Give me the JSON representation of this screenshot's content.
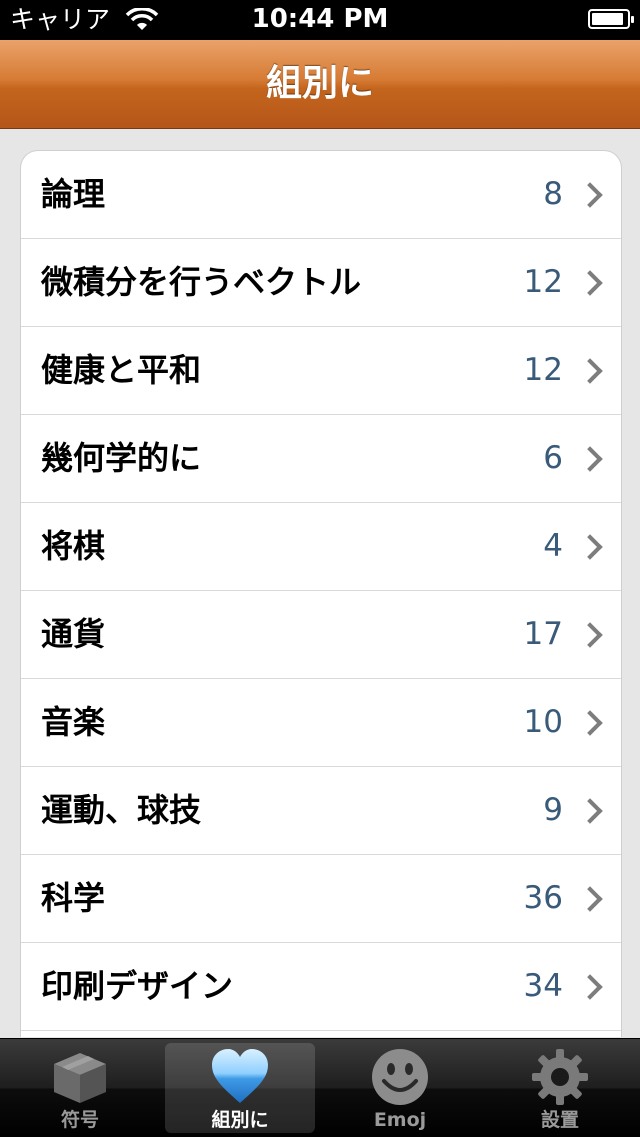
{
  "status_bar": {
    "carrier": "キャリア",
    "time": "10:44 PM",
    "battery_level": 0.9
  },
  "nav": {
    "title": "組別に"
  },
  "list": {
    "items": [
      {
        "label": "論理",
        "count": "8"
      },
      {
        "label": "微積分を行うベクトル",
        "count": "12"
      },
      {
        "label": "健康と平和",
        "count": "12"
      },
      {
        "label": "幾何学的に",
        "count": "6"
      },
      {
        "label": "将棋",
        "count": "4"
      },
      {
        "label": "通貨",
        "count": "17"
      },
      {
        "label": "音楽",
        "count": "10"
      },
      {
        "label": "運動、球技",
        "count": "9"
      },
      {
        "label": "科学",
        "count": "36"
      },
      {
        "label": "印刷デザイン",
        "count": "34"
      }
    ]
  },
  "tabbar": {
    "tabs": [
      {
        "label": "符号",
        "icon": "box-icon",
        "selected": false
      },
      {
        "label": "組別に",
        "icon": "heart-icon",
        "selected": true
      },
      {
        "label": "Emoj",
        "icon": "smiley-icon",
        "selected": false
      },
      {
        "label": "設置",
        "icon": "gear-icon",
        "selected": false
      }
    ]
  },
  "colors": {
    "nav_orange": "#c4651d",
    "count_blue": "#395a78",
    "heart_blue": "#4aa3e8"
  }
}
